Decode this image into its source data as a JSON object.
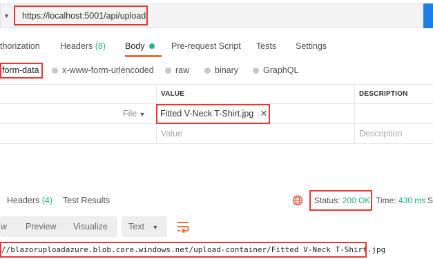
{
  "request": {
    "method_caret": "▼",
    "url": "https://localhost:5001/api/upload"
  },
  "request_tabs": {
    "authorization": "thorization",
    "headers": "Headers",
    "headers_count": "(8)",
    "body": "Body",
    "pre_request": "Pre-request Script",
    "tests": "Tests",
    "settings": "Settings"
  },
  "body_types": {
    "form_data": "form-data",
    "urlencoded": "x-www-form-urlencoded",
    "raw": "raw",
    "binary": "binary",
    "graphql": "GraphQL"
  },
  "table": {
    "headers": {
      "value": "VALUE",
      "description": "DESCRIPTION"
    },
    "row1": {
      "type": "File",
      "type_caret": "▼",
      "file_name": "Fitted V-Neck T-Shirt.jpg",
      "remove": "✕"
    },
    "row2": {
      "value_placeholder": "Value",
      "description_placeholder": "Description"
    }
  },
  "response_tabs": {
    "headers": "Headers",
    "headers_count": "(4)",
    "test_results": "Test Results"
  },
  "status": {
    "label": "Status:",
    "code": "200 OK",
    "time_label": "Time:",
    "time_value": "430 ms",
    "size_cut": "S"
  },
  "response_toolbar": {
    "pretty_cut": "w",
    "preview": "Preview",
    "visualize": "Visualize",
    "format": "Text",
    "format_caret": "▼"
  },
  "response_body": "//blazoruploadazure.blob.core.windows.net/upload-container/Fitted V-Neck T-Shirt.jpg",
  "colors": {
    "accent_orange": "#f26b3a",
    "green": "#26b47f",
    "highlight_red": "#e53935",
    "send_blue": "#1f7ee5"
  }
}
